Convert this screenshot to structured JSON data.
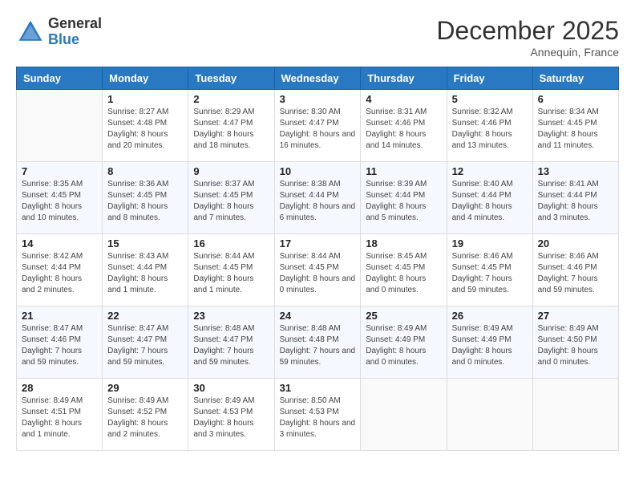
{
  "header": {
    "logo_general": "General",
    "logo_blue": "Blue",
    "month_title": "December 2025",
    "location": "Annequin, France"
  },
  "days_of_week": [
    "Sunday",
    "Monday",
    "Tuesday",
    "Wednesday",
    "Thursday",
    "Friday",
    "Saturday"
  ],
  "weeks": [
    [
      {
        "day": "",
        "sunrise": "",
        "sunset": "",
        "daylight": ""
      },
      {
        "day": "1",
        "sunrise": "8:27 AM",
        "sunset": "4:48 PM",
        "daylight": "8 hours and 20 minutes."
      },
      {
        "day": "2",
        "sunrise": "8:29 AM",
        "sunset": "4:47 PM",
        "daylight": "8 hours and 18 minutes."
      },
      {
        "day": "3",
        "sunrise": "8:30 AM",
        "sunset": "4:47 PM",
        "daylight": "8 hours and 16 minutes."
      },
      {
        "day": "4",
        "sunrise": "8:31 AM",
        "sunset": "4:46 PM",
        "daylight": "8 hours and 14 minutes."
      },
      {
        "day": "5",
        "sunrise": "8:32 AM",
        "sunset": "4:46 PM",
        "daylight": "8 hours and 13 minutes."
      },
      {
        "day": "6",
        "sunrise": "8:34 AM",
        "sunset": "4:45 PM",
        "daylight": "8 hours and 11 minutes."
      }
    ],
    [
      {
        "day": "7",
        "sunrise": "8:35 AM",
        "sunset": "4:45 PM",
        "daylight": "8 hours and 10 minutes."
      },
      {
        "day": "8",
        "sunrise": "8:36 AM",
        "sunset": "4:45 PM",
        "daylight": "8 hours and 8 minutes."
      },
      {
        "day": "9",
        "sunrise": "8:37 AM",
        "sunset": "4:45 PM",
        "daylight": "8 hours and 7 minutes."
      },
      {
        "day": "10",
        "sunrise": "8:38 AM",
        "sunset": "4:44 PM",
        "daylight": "8 hours and 6 minutes."
      },
      {
        "day": "11",
        "sunrise": "8:39 AM",
        "sunset": "4:44 PM",
        "daylight": "8 hours and 5 minutes."
      },
      {
        "day": "12",
        "sunrise": "8:40 AM",
        "sunset": "4:44 PM",
        "daylight": "8 hours and 4 minutes."
      },
      {
        "day": "13",
        "sunrise": "8:41 AM",
        "sunset": "4:44 PM",
        "daylight": "8 hours and 3 minutes."
      }
    ],
    [
      {
        "day": "14",
        "sunrise": "8:42 AM",
        "sunset": "4:44 PM",
        "daylight": "8 hours and 2 minutes."
      },
      {
        "day": "15",
        "sunrise": "8:43 AM",
        "sunset": "4:44 PM",
        "daylight": "8 hours and 1 minute."
      },
      {
        "day": "16",
        "sunrise": "8:44 AM",
        "sunset": "4:45 PM",
        "daylight": "8 hours and 1 minute."
      },
      {
        "day": "17",
        "sunrise": "8:44 AM",
        "sunset": "4:45 PM",
        "daylight": "8 hours and 0 minutes."
      },
      {
        "day": "18",
        "sunrise": "8:45 AM",
        "sunset": "4:45 PM",
        "daylight": "8 hours and 0 minutes."
      },
      {
        "day": "19",
        "sunrise": "8:46 AM",
        "sunset": "4:45 PM",
        "daylight": "7 hours and 59 minutes."
      },
      {
        "day": "20",
        "sunrise": "8:46 AM",
        "sunset": "4:46 PM",
        "daylight": "7 hours and 59 minutes."
      }
    ],
    [
      {
        "day": "21",
        "sunrise": "8:47 AM",
        "sunset": "4:46 PM",
        "daylight": "7 hours and 59 minutes."
      },
      {
        "day": "22",
        "sunrise": "8:47 AM",
        "sunset": "4:47 PM",
        "daylight": "7 hours and 59 minutes."
      },
      {
        "day": "23",
        "sunrise": "8:48 AM",
        "sunset": "4:47 PM",
        "daylight": "7 hours and 59 minutes."
      },
      {
        "day": "24",
        "sunrise": "8:48 AM",
        "sunset": "4:48 PM",
        "daylight": "7 hours and 59 minutes."
      },
      {
        "day": "25",
        "sunrise": "8:49 AM",
        "sunset": "4:49 PM",
        "daylight": "8 hours and 0 minutes."
      },
      {
        "day": "26",
        "sunrise": "8:49 AM",
        "sunset": "4:49 PM",
        "daylight": "8 hours and 0 minutes."
      },
      {
        "day": "27",
        "sunrise": "8:49 AM",
        "sunset": "4:50 PM",
        "daylight": "8 hours and 0 minutes."
      }
    ],
    [
      {
        "day": "28",
        "sunrise": "8:49 AM",
        "sunset": "4:51 PM",
        "daylight": "8 hours and 1 minute."
      },
      {
        "day": "29",
        "sunrise": "8:49 AM",
        "sunset": "4:52 PM",
        "daylight": "8 hours and 2 minutes."
      },
      {
        "day": "30",
        "sunrise": "8:49 AM",
        "sunset": "4:53 PM",
        "daylight": "8 hours and 3 minutes."
      },
      {
        "day": "31",
        "sunrise": "8:50 AM",
        "sunset": "4:53 PM",
        "daylight": "8 hours and 3 minutes."
      },
      {
        "day": "",
        "sunrise": "",
        "sunset": "",
        "daylight": ""
      },
      {
        "day": "",
        "sunrise": "",
        "sunset": "",
        "daylight": ""
      },
      {
        "day": "",
        "sunrise": "",
        "sunset": "",
        "daylight": ""
      }
    ]
  ]
}
